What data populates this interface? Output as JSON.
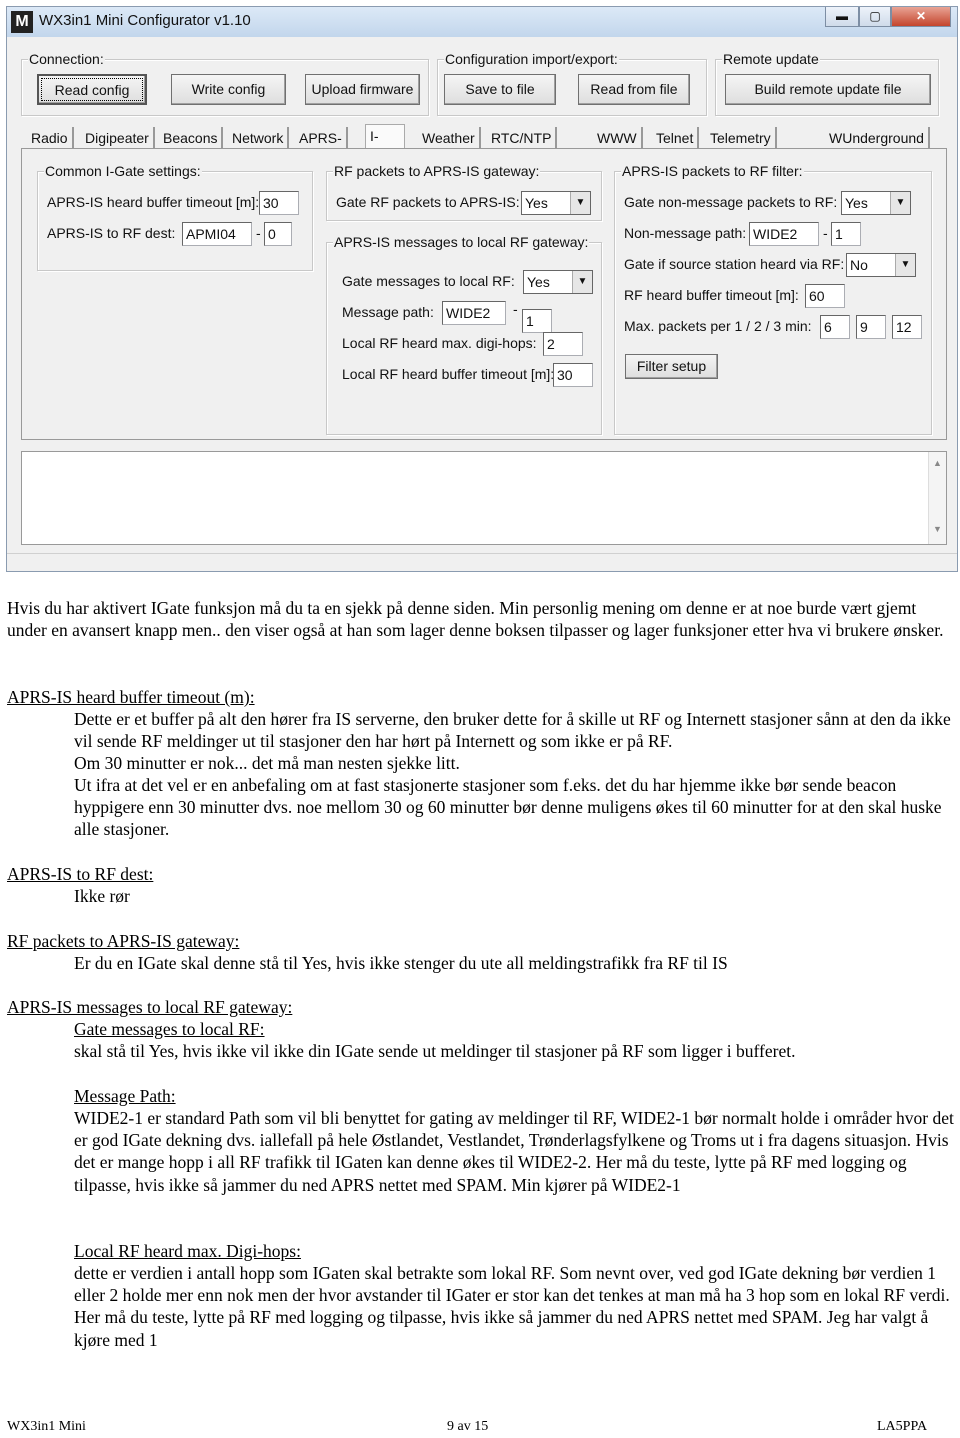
{
  "window": {
    "title": "WX3in1 Mini Configurator v1.10",
    "logo": "M",
    "controls": [
      "minimize-icon",
      "maximize-icon",
      "close-icon"
    ]
  },
  "connection": {
    "legend": "Connection:",
    "read": "Read config",
    "write": "Write config",
    "upload": "Upload firmware"
  },
  "importexport": {
    "legend": "Configuration import/export:",
    "save": "Save to file",
    "read": "Read from file"
  },
  "remote": {
    "legend": "Remote update",
    "build": "Build remote update file"
  },
  "tabs": [
    "Radio",
    "Digipeater",
    "Beacons",
    "Network",
    "APRS-IS",
    "I-Gate",
    "Weather",
    "RTC/NTP time",
    "WWW",
    "Telnet",
    "Telemetry reports",
    "WUnderground"
  ],
  "selected_tab": "I-Gate",
  "common": {
    "legend": "Common I-Gate settings:",
    "timeout_label": "APRS-IS heard buffer timeout [m]:",
    "timeout": "30",
    "dest_label": "APRS-IS to RF dest:",
    "dest": "APMI04",
    "dest_sep": "-",
    "dest_ssid": "0"
  },
  "rfgw": {
    "legend": "RF packets to APRS-IS gateway:",
    "gate_label": "Gate RF packets to APRS-IS:",
    "gate": "Yes"
  },
  "msggw": {
    "legend": "APRS-IS messages to local RF gateway:",
    "gate_label": "Gate messages to local RF:",
    "gate": "Yes",
    "path_label": "Message path:",
    "path": "WIDE2",
    "path_sep": "-",
    "path_n": "1",
    "hops_label": "Local RF heard max. digi-hops:",
    "hops": "2",
    "timeout_label": "Local RF heard buffer timeout [m]:",
    "timeout": "30"
  },
  "filter": {
    "legend": "APRS-IS packets to RF filter:",
    "nonmsg_label": "Gate non-message packets to RF:",
    "nonmsg": "Yes",
    "path_label": "Non-message path:",
    "path": "WIDE2",
    "path_sep": "-",
    "path_n": "1",
    "src_label": "Gate if source station heard via RF:",
    "src": "No",
    "rf_timeout_label": "RF heard buffer timeout [m]:",
    "rf_timeout": "60",
    "max_label": "Max. packets per 1 / 2 / 3 min:",
    "max1": "6",
    "max2": "9",
    "max3": "12",
    "setup": "Filter setup"
  },
  "doc": {
    "intro": "Hvis du har aktivert IGate funksjon må du ta en sjekk på denne siden. Min personlig mening om denne er at noe burde vært gjemt under en avansert knapp men.. den viser også at han som lager denne boksen tilpasser og lager funksjoner etter hva vi brukere ønsker.",
    "h1": "APRS-IS heard buffer timeout (m):",
    "p1a": "Dette er et buffer på alt den hører fra IS serverne, den bruker dette for å skille ut RF og Internett stasjoner sånn at den da ikke vil sende RF meldinger ut til stasjoner den har hørt på Internett og som ikke er på RF.",
    "p1b": "Om 30 minutter er nok... det må man nesten sjekke litt.",
    "p1c": "Ut ifra at det vel er en anbefaling om at fast stasjonerte stasjoner som f.eks. det du har hjemme ikke bør sende beacon hyppigere enn 30 minutter dvs. noe mellom 30 og 60 minutter bør denne muligens økes til 60 minutter for at den skal huske alle stasjoner.",
    "h2": "APRS-IS to RF dest:",
    "p2": "Ikke rør",
    "h3": "RF packets to APRS-IS gateway:",
    "p3": "Er du en IGate skal denne stå til Yes, hvis ikke stenger du ute all meldingstrafikk fra RF til IS",
    "h4": "APRS-IS messages to local RF gateway:",
    "h4a": "Gate messages to local RF:",
    "p4a": "skal stå til Yes, hvis ikke vil ikke din IGate sende ut meldinger til stasjoner på RF som ligger i bufferet.",
    "h4b": "Message Path:",
    "p4b": "WIDE2-1 er standard Path som vil bli benyttet for gating av meldinger til RF, WIDE2-1 bør normalt holde i områder hvor det er god IGate dekning dvs. iallefall på hele Østlandet, Vestlandet, Trønderlagsfylkene og Troms ut i fra dagens situasjon. Hvis det er mange hopp i all RF trafikk til IGaten kan denne økes til WIDE2-2. Her må du teste, lytte på RF med logging og tilpasse, hvis ikke så jammer du ned APRS nettet med SPAM. Min kjører på WIDE2-1",
    "h4c": "Local RF heard max. Digi-hops:",
    "p4c": "dette er verdien i antall hopp som IGaten skal betrakte som lokal RF. Som nevnt over, ved god IGate dekning bør verdien 1 eller 2 holde mer enn nok men der hvor avstander til IGater er stor kan det tenkes at man må ha 3 hop som en lokal RF verdi. Her må du teste, lytte på RF med logging og tilpasse, hvis ikke så jammer du ned APRS nettet med SPAM. Jeg har valgt å kjøre med 1"
  },
  "footer": {
    "left": "WX3in1 Mini",
    "center": "9 av 15",
    "right": "LA5PPA"
  }
}
